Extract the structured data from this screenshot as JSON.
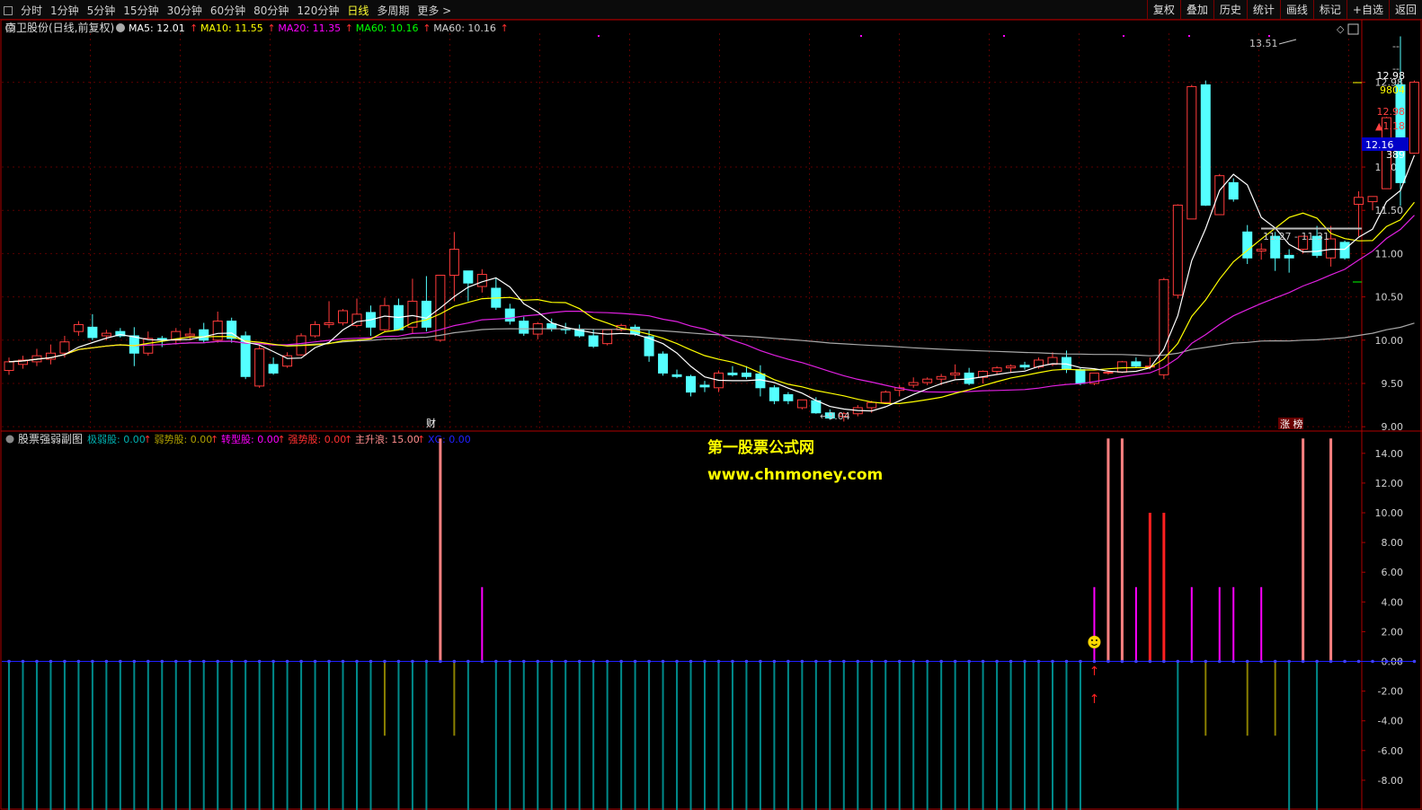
{
  "toolbar": {
    "periods": [
      "分时",
      "1分钟",
      "5分钟",
      "15分钟",
      "30分钟",
      "60分钟",
      "80分钟",
      "120分钟",
      "日线",
      "多周期",
      "更多 >"
    ],
    "active_period": "日线",
    "actions": [
      "复权",
      "叠加",
      "历史",
      "统计",
      "画线",
      "标记",
      "+自选",
      "返回"
    ]
  },
  "price_panel": {
    "stock_name": "南卫股份(日线,前复权)",
    "ma_legend": [
      {
        "label": "MA5: 12.01",
        "color": "#ffffff"
      },
      {
        "label": "MA10: 11.55",
        "color": "#ffff00"
      },
      {
        "label": "MA20: 11.35",
        "color": "#ff00ff"
      },
      {
        "label": "MA60: 10.16",
        "color": "#00ff00"
      },
      {
        "label": "MA60: 10.16",
        "color": "#cfcfcf"
      }
    ],
    "yaxis_ticks": [
      12.98,
      12.0,
      11.5,
      11.0,
      10.5,
      10.0,
      9.5,
      9.0
    ],
    "ylim": [
      8.95,
      13.65
    ],
    "right_panel": {
      "price": "12.98",
      "volume": "9804",
      "price2": "12.98",
      "change": "▲1.18",
      "current": "12.16",
      "current2": "389"
    },
    "annotations": {
      "high": "13.51",
      "low": "9.04",
      "range": "11.27 - 11.31",
      "event_cai": "财",
      "event_zt": "涨 榜"
    },
    "right_dash1": "--",
    "right_dash2": "--"
  },
  "indicator_panel": {
    "title": "股票强弱副图",
    "legend": [
      {
        "label": "极弱股: 0.00",
        "color": "#00b0b0"
      },
      {
        "label": "弱势股: 0.00",
        "color": "#b0a000"
      },
      {
        "label": "转型股: 0.00",
        "color": "#ff00ff"
      },
      {
        "label": "强势股: 0.00",
        "color": "#ff3030"
      },
      {
        "label": "主升浪: 15.00",
        "color": "#ff8c8c"
      },
      {
        "label": "XG: 0.00",
        "color": "#2020ff"
      }
    ],
    "yaxis_ticks": [
      14.0,
      12.0,
      10.0,
      8.0,
      6.0,
      4.0,
      2.0,
      0.0,
      -2.0,
      -4.0,
      -6.0,
      -8.0
    ],
    "ylim": [
      -10,
      15.5
    ]
  },
  "watermark": {
    "line1": "第一股票公式网",
    "line2": "www.chnmoney.com"
  },
  "chart_data": {
    "type": "candlestick",
    "candles": [
      {
        "o": 9.65,
        "h": 9.8,
        "l": 9.6,
        "c": 9.75
      },
      {
        "o": 9.72,
        "h": 9.82,
        "l": 9.67,
        "c": 9.77
      },
      {
        "o": 9.75,
        "h": 9.9,
        "l": 9.7,
        "c": 9.82
      },
      {
        "o": 9.78,
        "h": 9.95,
        "l": 9.72,
        "c": 9.85
      },
      {
        "o": 9.85,
        "h": 10.05,
        "l": 9.8,
        "c": 9.98
      },
      {
        "o": 10.1,
        "h": 10.22,
        "l": 10.05,
        "c": 10.18
      },
      {
        "o": 10.15,
        "h": 10.3,
        "l": 10.0,
        "c": 10.03
      },
      {
        "o": 10.05,
        "h": 10.12,
        "l": 10.0,
        "c": 10.08
      },
      {
        "o": 10.1,
        "h": 10.14,
        "l": 10.03,
        "c": 10.05
      },
      {
        "o": 10.05,
        "h": 10.15,
        "l": 9.7,
        "c": 9.85
      },
      {
        "o": 9.85,
        "h": 10.1,
        "l": 9.82,
        "c": 10.02
      },
      {
        "o": 10.02,
        "h": 10.05,
        "l": 9.92,
        "c": 10.0
      },
      {
        "o": 10.0,
        "h": 10.14,
        "l": 9.95,
        "c": 10.1
      },
      {
        "o": 10.05,
        "h": 10.14,
        "l": 10.0,
        "c": 10.07
      },
      {
        "o": 10.12,
        "h": 10.2,
        "l": 9.97,
        "c": 10.0
      },
      {
        "o": 10.0,
        "h": 10.33,
        "l": 9.97,
        "c": 10.22
      },
      {
        "o": 10.22,
        "h": 10.26,
        "l": 9.97,
        "c": 10.02
      },
      {
        "o": 10.05,
        "h": 10.1,
        "l": 9.55,
        "c": 9.58
      },
      {
        "o": 9.47,
        "h": 9.95,
        "l": 9.45,
        "c": 9.9
      },
      {
        "o": 9.72,
        "h": 9.8,
        "l": 9.6,
        "c": 9.62
      },
      {
        "o": 9.7,
        "h": 9.86,
        "l": 9.68,
        "c": 9.82
      },
      {
        "o": 9.83,
        "h": 10.08,
        "l": 9.82,
        "c": 10.05
      },
      {
        "o": 10.05,
        "h": 10.22,
        "l": 10.03,
        "c": 10.18
      },
      {
        "o": 10.18,
        "h": 10.45,
        "l": 10.14,
        "c": 10.2
      },
      {
        "o": 10.2,
        "h": 10.36,
        "l": 10.17,
        "c": 10.34
      },
      {
        "o": 10.17,
        "h": 10.48,
        "l": 10.15,
        "c": 10.3
      },
      {
        "o": 10.32,
        "h": 10.4,
        "l": 10.05,
        "c": 10.15
      },
      {
        "o": 10.12,
        "h": 10.49,
        "l": 10.1,
        "c": 10.4
      },
      {
        "o": 10.4,
        "h": 10.48,
        "l": 10.12,
        "c": 10.12
      },
      {
        "o": 10.15,
        "h": 10.71,
        "l": 10.08,
        "c": 10.45
      },
      {
        "o": 10.45,
        "h": 10.74,
        "l": 10.1,
        "c": 10.15
      },
      {
        "o": 10.0,
        "h": 10.2,
        "l": 9.98,
        "c": 10.75
      },
      {
        "o": 10.75,
        "h": 11.25,
        "l": 10.45,
        "c": 11.05
      },
      {
        "o": 10.8,
        "h": 10.7,
        "l": 10.45,
        "c": 10.66
      },
      {
        "o": 10.62,
        "h": 10.82,
        "l": 10.55,
        "c": 10.76
      },
      {
        "o": 10.6,
        "h": 10.72,
        "l": 10.35,
        "c": 10.38
      },
      {
        "o": 10.36,
        "h": 10.42,
        "l": 10.18,
        "c": 10.22
      },
      {
        "o": 10.22,
        "h": 10.27,
        "l": 10.05,
        "c": 10.08
      },
      {
        "o": 10.07,
        "h": 10.21,
        "l": 10.01,
        "c": 10.19
      },
      {
        "o": 10.19,
        "h": 10.25,
        "l": 10.1,
        "c": 10.13
      },
      {
        "o": 10.13,
        "h": 10.2,
        "l": 10.07,
        "c": 10.12
      },
      {
        "o": 10.12,
        "h": 10.18,
        "l": 10.03,
        "c": 10.05
      },
      {
        "o": 10.05,
        "h": 10.13,
        "l": 9.91,
        "c": 9.93
      },
      {
        "o": 9.96,
        "h": 10.12,
        "l": 9.94,
        "c": 10.12
      },
      {
        "o": 10.12,
        "h": 10.19,
        "l": 10.1,
        "c": 10.17
      },
      {
        "o": 10.15,
        "h": 10.18,
        "l": 10.05,
        "c": 10.07
      },
      {
        "o": 10.04,
        "h": 10.12,
        "l": 9.75,
        "c": 9.82
      },
      {
        "o": 9.84,
        "h": 9.87,
        "l": 9.59,
        "c": 9.62
      },
      {
        "o": 9.6,
        "h": 9.66,
        "l": 9.56,
        "c": 9.58
      },
      {
        "o": 9.58,
        "h": 9.6,
        "l": 9.35,
        "c": 9.4
      },
      {
        "o": 9.48,
        "h": 9.53,
        "l": 9.4,
        "c": 9.46
      },
      {
        "o": 9.45,
        "h": 9.65,
        "l": 9.4,
        "c": 9.62
      },
      {
        "o": 9.62,
        "h": 9.7,
        "l": 9.58,
        "c": 9.6
      },
      {
        "o": 9.62,
        "h": 9.7,
        "l": 9.55,
        "c": 9.58
      },
      {
        "o": 9.61,
        "h": 9.71,
        "l": 9.35,
        "c": 9.45
      },
      {
        "o": 9.45,
        "h": 9.48,
        "l": 9.26,
        "c": 9.3
      },
      {
        "o": 9.37,
        "h": 9.4,
        "l": 9.26,
        "c": 9.3
      },
      {
        "o": 9.22,
        "h": 9.31,
        "l": 9.2,
        "c": 9.31
      },
      {
        "o": 9.3,
        "h": 9.34,
        "l": 9.15,
        "c": 9.16
      },
      {
        "o": 9.16,
        "h": 9.2,
        "l": 9.08,
        "c": 9.1
      },
      {
        "o": 9.12,
        "h": 9.17,
        "l": 9.06,
        "c": 9.15
      },
      {
        "o": 9.15,
        "h": 9.25,
        "l": 9.12,
        "c": 9.22
      },
      {
        "o": 9.22,
        "h": 9.3,
        "l": 9.16,
        "c": 9.28
      },
      {
        "o": 9.28,
        "h": 9.42,
        "l": 9.26,
        "c": 9.4
      },
      {
        "o": 9.42,
        "h": 9.48,
        "l": 9.35,
        "c": 9.45
      },
      {
        "o": 9.48,
        "h": 9.57,
        "l": 9.45,
        "c": 9.51
      },
      {
        "o": 9.51,
        "h": 9.57,
        "l": 9.48,
        "c": 9.55
      },
      {
        "o": 9.55,
        "h": 9.61,
        "l": 9.48,
        "c": 9.58
      },
      {
        "o": 9.6,
        "h": 9.72,
        "l": 9.55,
        "c": 9.62
      },
      {
        "o": 9.62,
        "h": 9.68,
        "l": 9.48,
        "c": 9.5
      },
      {
        "o": 9.57,
        "h": 9.65,
        "l": 9.5,
        "c": 9.64
      },
      {
        "o": 9.64,
        "h": 9.7,
        "l": 9.6,
        "c": 9.68
      },
      {
        "o": 9.68,
        "h": 9.72,
        "l": 9.62,
        "c": 9.7
      },
      {
        "o": 9.71,
        "h": 9.75,
        "l": 9.66,
        "c": 9.69
      },
      {
        "o": 9.69,
        "h": 9.8,
        "l": 9.67,
        "c": 9.77
      },
      {
        "o": 9.72,
        "h": 9.86,
        "l": 9.7,
        "c": 9.8
      },
      {
        "o": 9.8,
        "h": 9.88,
        "l": 9.62,
        "c": 9.66
      },
      {
        "o": 9.66,
        "h": 9.68,
        "l": 9.48,
        "c": 9.5
      },
      {
        "o": 9.5,
        "h": 9.62,
        "l": 9.48,
        "c": 9.62
      },
      {
        "o": 9.62,
        "h": 9.65,
        "l": 9.6,
        "c": 9.63
      },
      {
        "o": 9.63,
        "h": 9.76,
        "l": 9.62,
        "c": 9.75
      },
      {
        "o": 9.75,
        "h": 9.8,
        "l": 9.68,
        "c": 9.7
      },
      {
        "o": 9.7,
        "h": 9.8,
        "l": 9.66,
        "c": 9.7
      },
      {
        "o": 9.6,
        "h": 10.72,
        "l": 9.55,
        "c": 10.7
      },
      {
        "o": 10.52,
        "h": 11.57,
        "l": 10.48,
        "c": 11.56
      },
      {
        "o": 11.4,
        "h": 12.95,
        "l": 11.4,
        "c": 12.93
      },
      {
        "o": 12.95,
        "h": 13.0,
        "l": 11.55,
        "c": 11.56
      },
      {
        "o": 11.45,
        "h": 11.92,
        "l": 11.45,
        "c": 11.9
      },
      {
        "o": 11.82,
        "h": 11.87,
        "l": 11.6,
        "c": 11.63
      },
      {
        "o": 11.25,
        "h": 11.33,
        "l": 10.88,
        "c": 10.95
      },
      {
        "o": 11.03,
        "h": 11.12,
        "l": 10.93,
        "c": 11.05
      },
      {
        "o": 11.2,
        "h": 11.25,
        "l": 10.8,
        "c": 10.95
      },
      {
        "o": 10.98,
        "h": 11.05,
        "l": 10.78,
        "c": 10.95
      },
      {
        "o": 11.05,
        "h": 11.2,
        "l": 11.0,
        "c": 11.2
      },
      {
        "o": 11.2,
        "h": 11.32,
        "l": 10.95,
        "c": 10.98
      },
      {
        "o": 10.95,
        "h": 11.32,
        "l": 10.85,
        "c": 11.17
      },
      {
        "o": 11.13,
        "h": 11.15,
        "l": 10.93,
        "c": 10.95
      },
      {
        "o": 11.57,
        "h": 11.72,
        "l": 11.2,
        "c": 11.65
      },
      {
        "o": 11.6,
        "h": 11.66,
        "l": 11.5,
        "c": 11.66
      },
      {
        "o": 11.75,
        "h": 12.58,
        "l": 11.75,
        "c": 12.57
      },
      {
        "o": 12.95,
        "h": 13.51,
        "l": 11.55,
        "c": 11.82
      },
      {
        "o": 12.16,
        "h": 13.0,
        "l": 12.16,
        "c": 12.98
      }
    ],
    "indicator_bars": [
      {
        "i": 0,
        "v": -10,
        "c": "#008a8a"
      },
      {
        "i": 1,
        "v": -10,
        "c": "#008a8a"
      },
      {
        "i": 2,
        "v": -10,
        "c": "#008a8a"
      },
      {
        "i": 3,
        "v": -10,
        "c": "#008a8a"
      },
      {
        "i": 4,
        "v": -10,
        "c": "#008a8a"
      },
      {
        "i": 5,
        "v": -10,
        "c": "#008a8a"
      },
      {
        "i": 6,
        "v": -10,
        "c": "#008a8a"
      },
      {
        "i": 7,
        "v": -10,
        "c": "#008a8a"
      },
      {
        "i": 8,
        "v": -10,
        "c": "#008a8a"
      },
      {
        "i": 9,
        "v": -10,
        "c": "#008a8a"
      },
      {
        "i": 10,
        "v": -10,
        "c": "#008a8a"
      },
      {
        "i": 11,
        "v": -10,
        "c": "#008a8a"
      },
      {
        "i": 12,
        "v": -10,
        "c": "#008a8a"
      },
      {
        "i": 13,
        "v": -10,
        "c": "#008a8a"
      },
      {
        "i": 14,
        "v": -10,
        "c": "#008a8a"
      },
      {
        "i": 15,
        "v": -10,
        "c": "#008a8a"
      },
      {
        "i": 16,
        "v": -10,
        "c": "#008a8a"
      },
      {
        "i": 17,
        "v": -10,
        "c": "#008a8a"
      },
      {
        "i": 18,
        "v": -10,
        "c": "#008a8a"
      },
      {
        "i": 19,
        "v": -10,
        "c": "#008a8a"
      },
      {
        "i": 20,
        "v": -10,
        "c": "#008a8a"
      },
      {
        "i": 21,
        "v": -10,
        "c": "#008a8a"
      },
      {
        "i": 22,
        "v": -10,
        "c": "#008a8a"
      },
      {
        "i": 23,
        "v": -10,
        "c": "#008a8a"
      },
      {
        "i": 24,
        "v": -10,
        "c": "#008a8a"
      },
      {
        "i": 25,
        "v": -10,
        "c": "#008a8a"
      },
      {
        "i": 26,
        "v": -10,
        "c": "#008a8a"
      },
      {
        "i": 27,
        "v": -5,
        "c": "#8a8000"
      },
      {
        "i": 28,
        "v": -10,
        "c": "#008a8a"
      },
      {
        "i": 29,
        "v": -10,
        "c": "#008a8a"
      },
      {
        "i": 30,
        "v": -10,
        "c": "#008a8a"
      },
      {
        "i": 31,
        "v": 15,
        "c": "#ff8080"
      },
      {
        "i": 32,
        "v": -5,
        "c": "#8a8000"
      },
      {
        "i": 33,
        "v": -10,
        "c": "#008a8a"
      },
      {
        "i": 34,
        "v": 5,
        "c": "#ff00ff"
      },
      {
        "i": 35,
        "v": -10,
        "c": "#008a8a"
      },
      {
        "i": 36,
        "v": -10,
        "c": "#008a8a"
      },
      {
        "i": 37,
        "v": -10,
        "c": "#008a8a"
      },
      {
        "i": 38,
        "v": -10,
        "c": "#008a8a"
      },
      {
        "i": 39,
        "v": -10,
        "c": "#008a8a"
      },
      {
        "i": 40,
        "v": -10,
        "c": "#008a8a"
      },
      {
        "i": 41,
        "v": -10,
        "c": "#008a8a"
      },
      {
        "i": 42,
        "v": -10,
        "c": "#008a8a"
      },
      {
        "i": 43,
        "v": -10,
        "c": "#008a8a"
      },
      {
        "i": 44,
        "v": -10,
        "c": "#008a8a"
      },
      {
        "i": 45,
        "v": -10,
        "c": "#008a8a"
      },
      {
        "i": 46,
        "v": -10,
        "c": "#008a8a"
      },
      {
        "i": 47,
        "v": -10,
        "c": "#008a8a"
      },
      {
        "i": 48,
        "v": -10,
        "c": "#008a8a"
      },
      {
        "i": 49,
        "v": -10,
        "c": "#008a8a"
      },
      {
        "i": 50,
        "v": -10,
        "c": "#008a8a"
      },
      {
        "i": 51,
        "v": -10,
        "c": "#008a8a"
      },
      {
        "i": 52,
        "v": -10,
        "c": "#008a8a"
      },
      {
        "i": 53,
        "v": -10,
        "c": "#008a8a"
      },
      {
        "i": 54,
        "v": -10,
        "c": "#008a8a"
      },
      {
        "i": 55,
        "v": -10,
        "c": "#008a8a"
      },
      {
        "i": 56,
        "v": -10,
        "c": "#008a8a"
      },
      {
        "i": 57,
        "v": -10,
        "c": "#008a8a"
      },
      {
        "i": 58,
        "v": -10,
        "c": "#008a8a"
      },
      {
        "i": 59,
        "v": -10,
        "c": "#008a8a"
      },
      {
        "i": 60,
        "v": -10,
        "c": "#008a8a"
      },
      {
        "i": 61,
        "v": -10,
        "c": "#008a8a"
      },
      {
        "i": 62,
        "v": -10,
        "c": "#008a8a"
      },
      {
        "i": 63,
        "v": -10,
        "c": "#008a8a"
      },
      {
        "i": 64,
        "v": -10,
        "c": "#008a8a"
      },
      {
        "i": 65,
        "v": -10,
        "c": "#008a8a"
      },
      {
        "i": 66,
        "v": -10,
        "c": "#008a8a"
      },
      {
        "i": 67,
        "v": -10,
        "c": "#008a8a"
      },
      {
        "i": 68,
        "v": -10,
        "c": "#008a8a"
      },
      {
        "i": 69,
        "v": -10,
        "c": "#008a8a"
      },
      {
        "i": 70,
        "v": -10,
        "c": "#008a8a"
      },
      {
        "i": 71,
        "v": -10,
        "c": "#008a8a"
      },
      {
        "i": 72,
        "v": -10,
        "c": "#008a8a"
      },
      {
        "i": 73,
        "v": -10,
        "c": "#008a8a"
      },
      {
        "i": 74,
        "v": -10,
        "c": "#008a8a"
      },
      {
        "i": 75,
        "v": -10,
        "c": "#008a8a"
      },
      {
        "i": 76,
        "v": -10,
        "c": "#008a8a"
      },
      {
        "i": 77,
        "v": -10,
        "c": "#008a8a"
      },
      {
        "i": 78,
        "v": 5,
        "c": "#ff00ff"
      },
      {
        "i": 79,
        "v": 15,
        "c": "#ff8080"
      },
      {
        "i": 80,
        "v": 15,
        "c": "#ff8080"
      },
      {
        "i": 81,
        "v": 5,
        "c": "#ff00ff"
      },
      {
        "i": 82,
        "v": 10,
        "c": "#ff2020"
      },
      {
        "i": 83,
        "v": 10,
        "c": "#ff2020"
      },
      {
        "i": 84,
        "v": -10,
        "c": "#008a8a"
      },
      {
        "i": 85,
        "v": 5,
        "c": "#ff00ff"
      },
      {
        "i": 86,
        "v": -5,
        "c": "#8a8000"
      },
      {
        "i": 87,
        "v": 5,
        "c": "#ff00ff"
      },
      {
        "i": 88,
        "v": 5,
        "c": "#ff00ff"
      },
      {
        "i": 89,
        "v": -5,
        "c": "#8a8000"
      },
      {
        "i": 90,
        "v": 5,
        "c": "#ff00ff"
      },
      {
        "i": 91,
        "v": -5,
        "c": "#8a8000"
      },
      {
        "i": 92,
        "v": -10,
        "c": "#008a8a"
      },
      {
        "i": 93,
        "v": 15,
        "c": "#ff8080"
      },
      {
        "i": 94,
        "v": -10,
        "c": "#008a8a"
      },
      {
        "i": 95,
        "v": 15,
        "c": "#ff8080"
      }
    ]
  }
}
